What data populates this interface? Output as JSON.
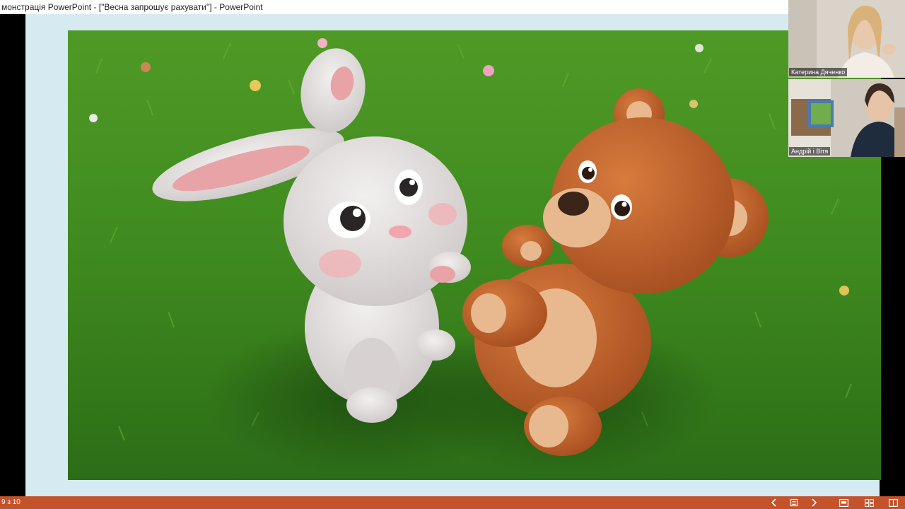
{
  "window": {
    "title": "монстрація PowerPoint - [\"Весна запрошує рахувати\"] - PowerPoint"
  },
  "statusbar": {
    "slide_counter": "9 з 10",
    "prev_icon": "chevron-left-icon",
    "slide_notes_icon": "notes-icon",
    "next_icon": "chevron-right-icon",
    "normal_view_icon": "normal-view-icon",
    "sorter_view_icon": "slide-sorter-icon",
    "reading_view_icon": "reading-view-icon",
    "bar_color": "#c4532b"
  },
  "slide": {
    "background_color": "#d6eaf1",
    "image_description_hidden": true
  },
  "participants": [
    {
      "name": "Катерина Дяченко"
    },
    {
      "name": "Андрій і Вітя"
    }
  ]
}
